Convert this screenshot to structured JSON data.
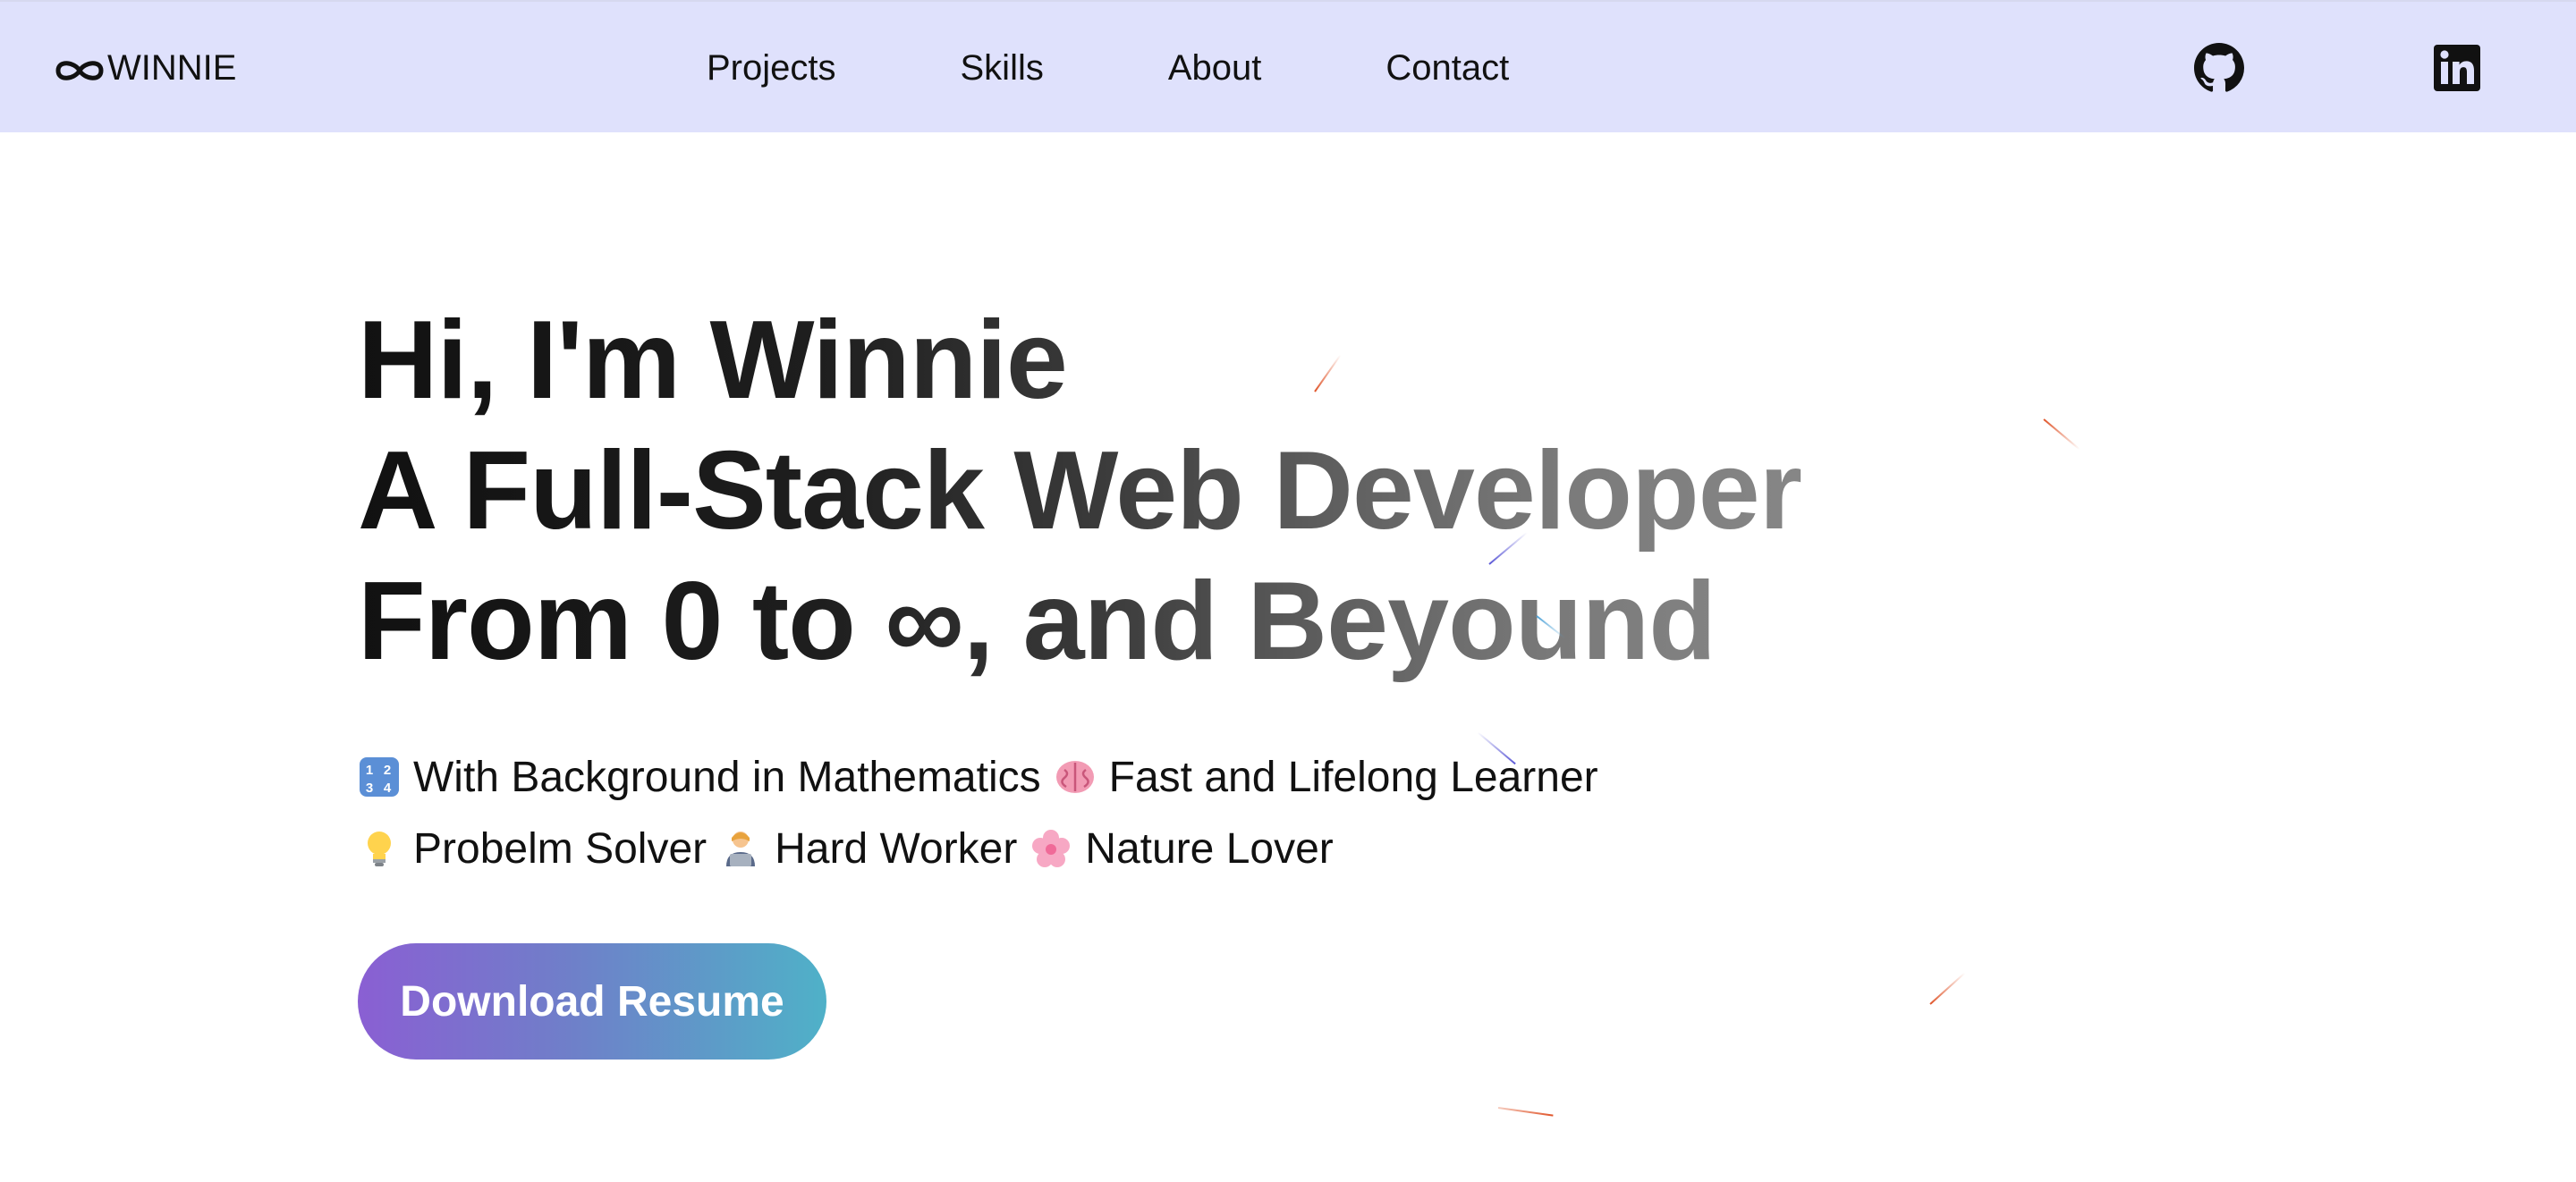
{
  "navbar": {
    "logo_text": "WINNIE",
    "logo_icon": "infinity-icon",
    "links": [
      {
        "label": "Projects"
      },
      {
        "label": "Skills"
      },
      {
        "label": "About"
      },
      {
        "label": "Contact"
      }
    ],
    "social": [
      {
        "name": "github-icon"
      },
      {
        "name": "linkedin-icon"
      }
    ],
    "background_color": "#dfe1fc"
  },
  "hero": {
    "headline": [
      "Hi, I'm Winnie",
      "A Full-Stack Web Developer",
      "From 0 to ∞, and Beyound"
    ],
    "traits": {
      "line1": [
        {
          "icon": "numbers-1234-icon",
          "text": "With Background in Mathematics"
        },
        {
          "icon": "brain-icon",
          "text": "Fast and Lifelong Learner"
        }
      ],
      "line2": [
        {
          "icon": "light-bulb-icon",
          "text": "Probelm Solver"
        },
        {
          "icon": "technologist-icon",
          "text": "Hard Worker"
        },
        {
          "icon": "cherry-blossom-icon",
          "text": "Nature Lover"
        }
      ]
    },
    "cta_label": "Download Resume",
    "cta_gradient": [
      "#8a5fd3",
      "#4fb1c8"
    ]
  }
}
